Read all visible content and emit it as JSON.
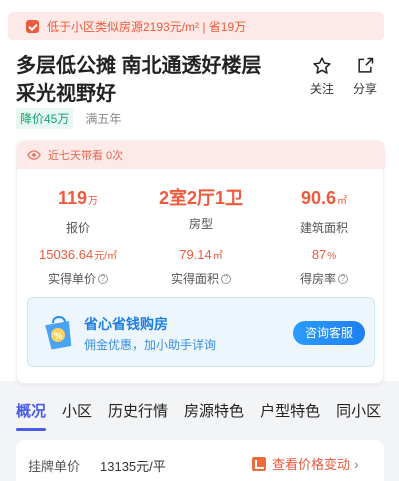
{
  "promo": {
    "text": "低于小区类似房源2193元/m² | 省19万"
  },
  "listing": {
    "title": "多层低公摊 南北通透好楼层 采光视野好",
    "tags": [
      "降价45万",
      "满五年"
    ]
  },
  "actions": {
    "follow": "关注",
    "share": "分享"
  },
  "viewed": {
    "text": "近七天带看 0次"
  },
  "stats": {
    "price": {
      "value": "119",
      "unit": "万",
      "label": "报价"
    },
    "layout": {
      "value": "2室2厅1卫",
      "label": "房型"
    },
    "area": {
      "value": "90.6",
      "unit": "㎡",
      "label": "建筑面积"
    },
    "unit_price": {
      "value": "15036.64",
      "unit": "元/㎡",
      "label": "实得单价"
    },
    "real_area": {
      "value": "79.14",
      "unit": "㎡",
      "label": "实得面积"
    },
    "ratio": {
      "value": "87",
      "unit": "%",
      "label": "得房率"
    }
  },
  "service": {
    "title": "省心省钱购房",
    "subtitle": "佣金优惠，加小助手详询",
    "button": "咨询客服"
  },
  "tabs": [
    "概况",
    "小区",
    "历史行情",
    "房源特色",
    "户型特色",
    "同小区"
  ],
  "bottom": {
    "listing_price_label": "挂牌单价",
    "listing_price_value": "13135元/平",
    "trend_link": "查看价格变动"
  },
  "colors": {
    "accent": "#f05a3c",
    "tab_active": "#4a5ce6",
    "green": "#13a36c",
    "blue": "#1f7fe0"
  }
}
